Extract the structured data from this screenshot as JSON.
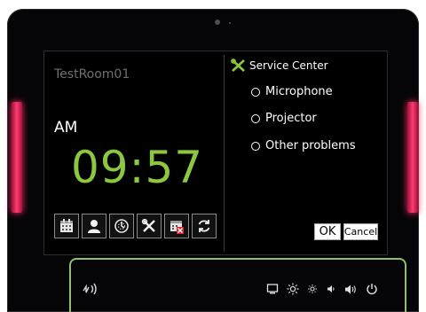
{
  "device": {
    "led_color": "#ff2b62"
  },
  "left_panel": {
    "room_name": "TestRoom01",
    "am_pm": "AM",
    "time": "09:57",
    "time_color": "#8dc63f",
    "toolbar_icons": [
      "calendar-icon",
      "user-icon",
      "timer-icon",
      "tools-icon",
      "calendar-cancel-icon",
      "refresh-icon"
    ]
  },
  "right_panel": {
    "title": "Service Center",
    "title_icon": "tools-icon",
    "options": [
      {
        "label": "Microphone"
      },
      {
        "label": "Projector"
      },
      {
        "label": "Other problems"
      }
    ],
    "ok_label": "OK",
    "cancel_label": "Cancel"
  },
  "bezel": {
    "icons": [
      "nfc-icon",
      "display-icon",
      "brightness-up-icon",
      "brightness-down-icon",
      "volume-down-icon",
      "volume-up-icon",
      "power-icon"
    ]
  }
}
